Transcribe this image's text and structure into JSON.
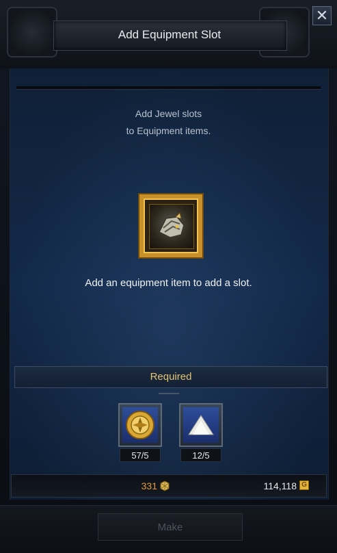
{
  "window": {
    "title": "Add Equipment Slot",
    "close_icon": "close-icon"
  },
  "description": {
    "line1": "Add Jewel slots",
    "line2": "to Equipment items."
  },
  "equipment_frame": {
    "icon": "helmet-icon"
  },
  "hint": "Add an equipment item to add a slot.",
  "required": {
    "label": "Required",
    "materials": [
      {
        "icon": "gold-coin-icon",
        "count": "57/5"
      },
      {
        "icon": "white-powder-icon",
        "count": "12/5"
      }
    ]
  },
  "currency": {
    "crystal": "331",
    "crystal_icon": "crystal-icon",
    "gold": "114,118",
    "gold_icon": "gold-icon"
  },
  "actions": {
    "make_label": "Make"
  },
  "colors": {
    "accent_gold": "#e3c36d",
    "crystal_orange": "#e59a2d",
    "frame_gold": "#c8902a"
  }
}
